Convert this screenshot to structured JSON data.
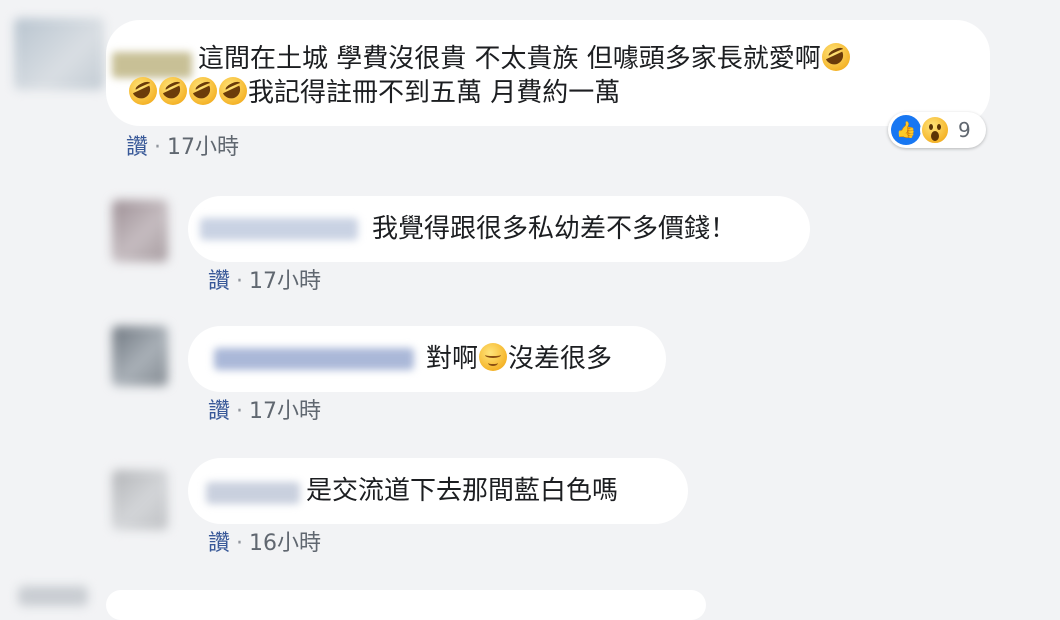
{
  "comments": [
    {
      "text_line1": "這間在土城 學費沒很貴 不太貴族 但噱頭多家長就愛啊",
      "text_line2": "我記得註冊不到五萬 月費約一萬",
      "like_label": "讚",
      "time": "17小時",
      "reactions": {
        "icons": [
          "like-icon",
          "wow-icon"
        ],
        "count": "9"
      }
    },
    {
      "text": "我覺得跟很多私幼差不多價錢！",
      "like_label": "讚",
      "time": "17小時"
    },
    {
      "text_before_emoji": "對啊",
      "emoji": "relieved-face-icon",
      "text_after_emoji": "沒差很多",
      "like_label": "讚",
      "time": "17小時"
    },
    {
      "text": "是交流道下去那間藍白色嗎",
      "like_label": "讚",
      "time": "16小時"
    }
  ],
  "separator": "·",
  "colors": {
    "background": "#f2f3f5",
    "bubble": "#ffffff",
    "link": "#385898",
    "meta": "#606770",
    "like_blue": "#1877f2"
  }
}
